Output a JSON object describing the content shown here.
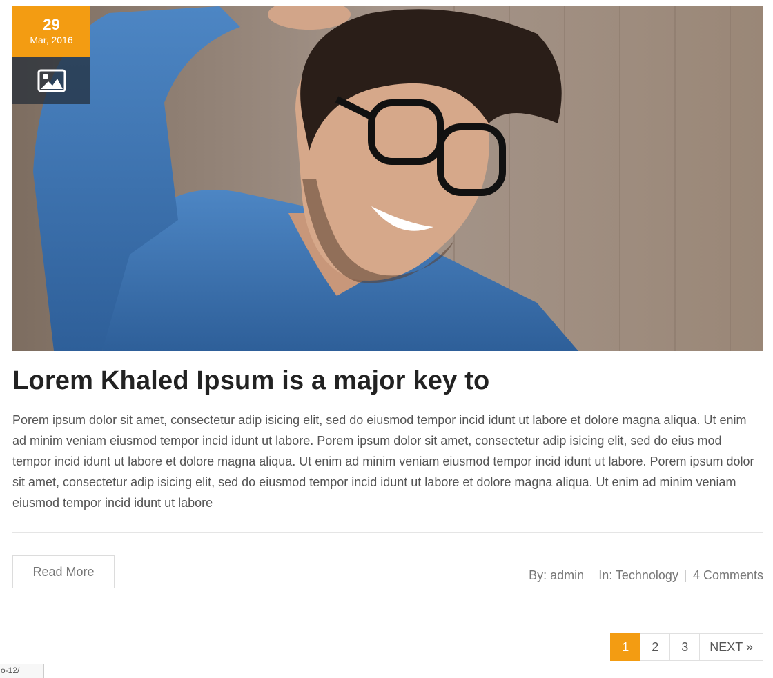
{
  "post": {
    "date": {
      "day": "29",
      "month": "Mar, 2016"
    },
    "format_icon": "image-icon",
    "title": "Lorem Khaled Ipsum is a major key to",
    "excerpt": "Porem ipsum dolor sit amet, consectetur adip isicing elit, sed do eiusmod tempor incid idunt ut labore et dolore magna aliqua. Ut enim ad minim veniam eiusmod tempor incid idunt ut labore. Porem ipsum dolor sit amet, consectetur adip isicing elit, sed do eius mod tempor incid idunt ut labore et dolore magna aliqua. Ut enim ad minim veniam eiusmod tempor incid idunt ut labore. Porem ipsum dolor sit amet, consectetur adip isicing elit, sed do eiusmod tempor incid idunt ut labore et dolore magna aliqua. Ut enim ad minim veniam eiusmod tempor incid idunt ut labore",
    "read_more_label": "Read More",
    "meta": {
      "author_label": "By: admin",
      "category_label": "In: Technology",
      "comments_label": "4 Comments"
    }
  },
  "pagination": {
    "pages": [
      "1",
      "2",
      "3"
    ],
    "active": "1",
    "next_label": "NEXT »"
  },
  "status_url": "o-12/",
  "colors": {
    "accent": "#f39c12",
    "format_box": "#232d37"
  }
}
